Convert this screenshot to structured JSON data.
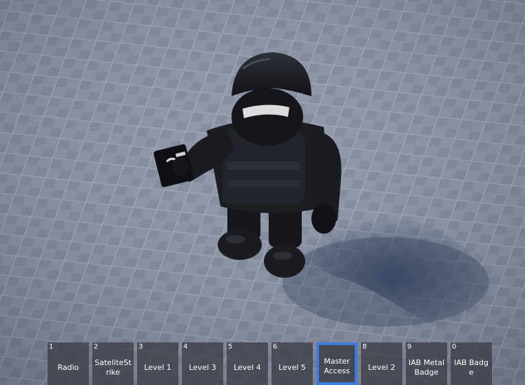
{
  "viewport": {
    "name": "game-viewport",
    "baseplate_color": "#7d8699",
    "character": "armored-avatar-holding-card"
  },
  "hotbar": {
    "selected_index": 6,
    "accent_color": "#3d7be0",
    "slots": [
      {
        "key": "1",
        "label": "Radio"
      },
      {
        "key": "2",
        "label": "SateliteStrike"
      },
      {
        "key": "3",
        "label": "Level 1"
      },
      {
        "key": "4",
        "label": "Level 3"
      },
      {
        "key": "5",
        "label": "Level 4"
      },
      {
        "key": "6",
        "label": "Level 5"
      },
      {
        "key": "",
        "label": "Master Access"
      },
      {
        "key": "8",
        "label": "Level 2"
      },
      {
        "key": "9",
        "label": "IAB Metal Badge"
      },
      {
        "key": "0",
        "label": "IAB Badge"
      }
    ]
  }
}
